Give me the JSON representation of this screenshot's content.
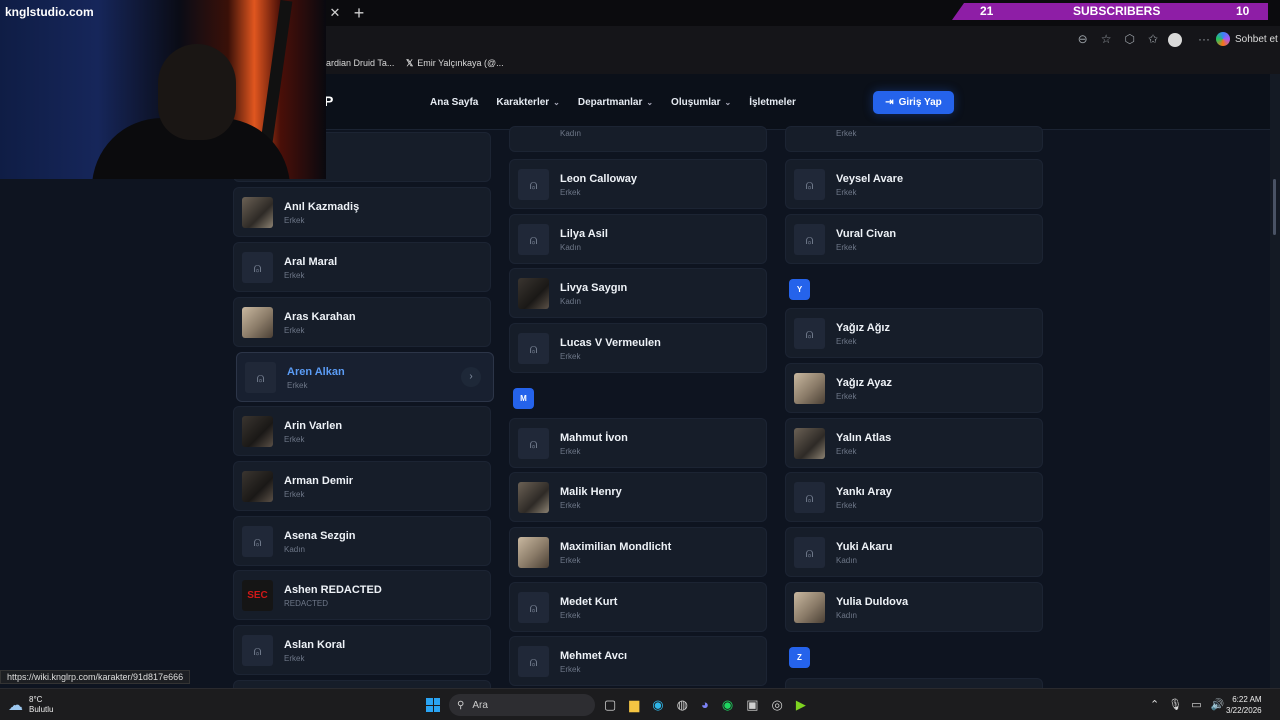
{
  "browser": {
    "bookmarks": [
      "ardian Druid Ta...",
      "Emir Yalçınkaya (@..."
    ],
    "copilot_label": "Sohbet et",
    "status_url": "https://wiki.knglrp.com/karakter/91d817e666"
  },
  "overlay": {
    "brand": "knglstudio.com",
    "subs_left": "21",
    "subs_label": "SUBSCRIBERS",
    "subs_right": "10"
  },
  "site": {
    "logo": "P",
    "nav": [
      "Ana Sayfa",
      "Karakterler",
      "Departmanlar",
      "Oluşumlar",
      "İşletmeler"
    ],
    "login": "Giriş Yap"
  },
  "letters": [
    "M",
    "Y",
    "Z"
  ],
  "col1": [
    {
      "name": "Anıl Kazmadiş",
      "sub": "Erkek",
      "avatar": "photo"
    },
    {
      "name": "Aral Maral",
      "sub": "Erkek",
      "avatar": "user-icon"
    },
    {
      "name": "Aras Karahan",
      "sub": "Erkek",
      "avatar": "photo"
    },
    {
      "name": "Aren Alkan",
      "sub": "Erkek",
      "avatar": "user-icon"
    },
    {
      "name": "Arin Varlen",
      "sub": "Erkek",
      "avatar": "photo"
    },
    {
      "name": "Arman Demir",
      "sub": "Erkek",
      "avatar": "photo"
    },
    {
      "name": "Asena Sezgin",
      "sub": "Kadın",
      "avatar": "user-icon"
    },
    {
      "name": "Ashen REDACTED",
      "sub": "REDACTED",
      "avatar": "secret"
    },
    {
      "name": "Aslan Koral",
      "sub": "Erkek",
      "avatar": "user-icon"
    }
  ],
  "col2": [
    {
      "name": "",
      "sub": "Kadın"
    },
    {
      "name": "Leon Calloway",
      "sub": "Erkek",
      "avatar": "user-icon"
    },
    {
      "name": "Lilya Asil",
      "sub": "Kadın",
      "avatar": "user-icon"
    },
    {
      "name": "Livya Saygın",
      "sub": "Kadın",
      "avatar": "photo"
    },
    {
      "name": "Lucas V Vermeulen",
      "sub": "Erkek",
      "avatar": "user-icon"
    },
    {
      "name": "Mahmut İvon",
      "sub": "Erkek",
      "avatar": "user-icon"
    },
    {
      "name": "Malik Henry",
      "sub": "Erkek",
      "avatar": "photo"
    },
    {
      "name": "Maximilian Mondlicht",
      "sub": "Erkek",
      "avatar": "photo"
    },
    {
      "name": "Medet Kurt",
      "sub": "Erkek",
      "avatar": "user-icon"
    },
    {
      "name": "Mehmet Avcı",
      "sub": "Erkek",
      "avatar": "user-icon"
    }
  ],
  "col3": [
    {
      "name": "",
      "sub": "Erkek"
    },
    {
      "name": "Veysel Avare",
      "sub": "Erkek",
      "avatar": "user-icon"
    },
    {
      "name": "Vural Civan",
      "sub": "Erkek",
      "avatar": "user-icon"
    },
    {
      "name": "Yağız Ağız",
      "sub": "Erkek",
      "avatar": "user-icon"
    },
    {
      "name": "Yağız Ayaz",
      "sub": "Erkek",
      "avatar": "photo"
    },
    {
      "name": "Yalın Atlas",
      "sub": "Erkek",
      "avatar": "photo"
    },
    {
      "name": "Yankı Aray",
      "sub": "Erkek",
      "avatar": "user-icon"
    },
    {
      "name": "Yuki Akaru",
      "sub": "Kadın",
      "avatar": "user-icon"
    },
    {
      "name": "Yulia Duldova",
      "sub": "Kadın",
      "avatar": "photo"
    }
  ],
  "taskbar": {
    "temp": "8°C",
    "weather": "Bulutlu",
    "search": "Ara",
    "time": "6:22 AM",
    "date": "3/22/2026"
  }
}
